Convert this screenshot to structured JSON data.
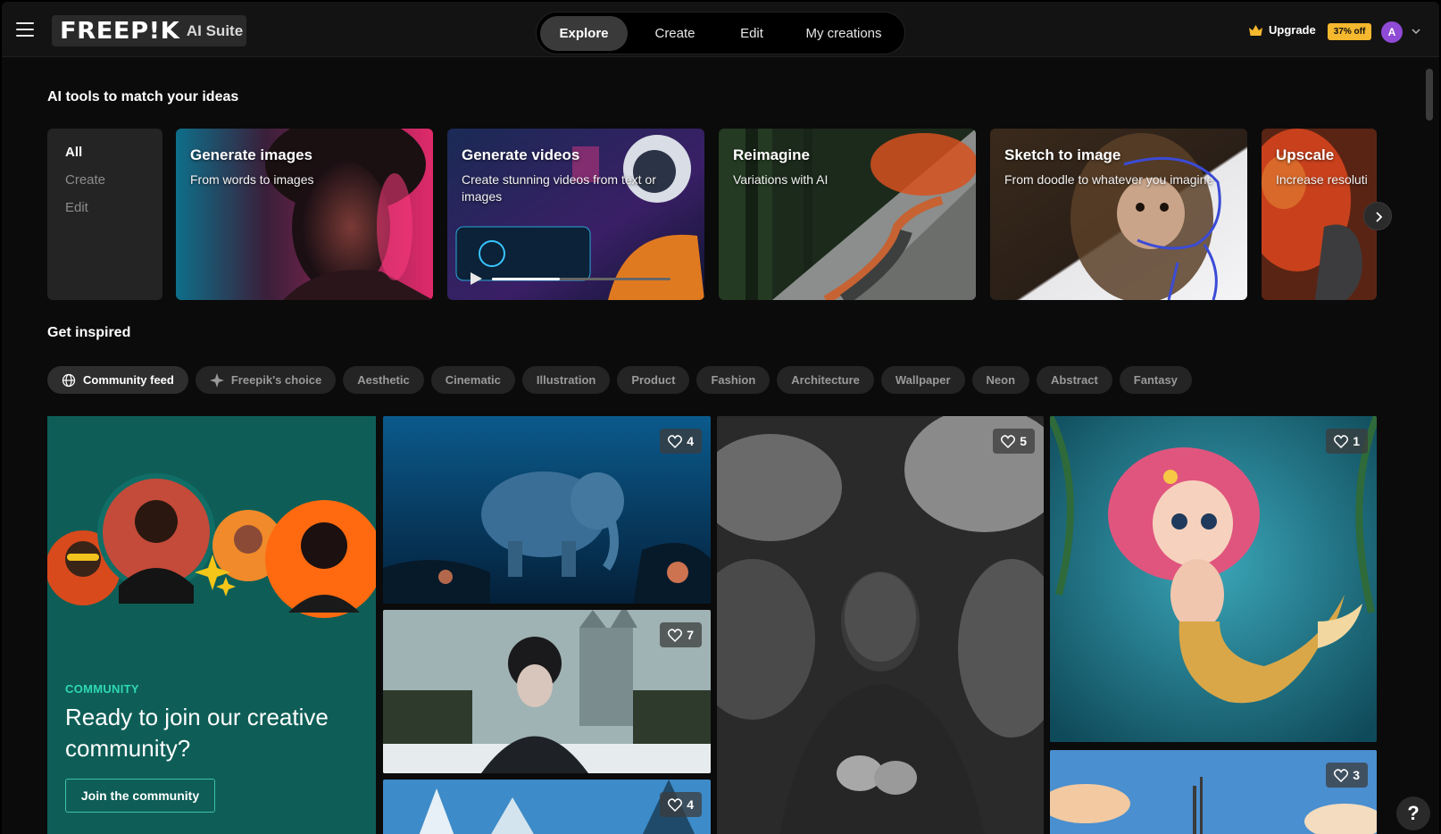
{
  "header": {
    "logo": "FREEP!K",
    "suite_label": "AI Suite",
    "nav": [
      {
        "label": "Explore",
        "active": true
      },
      {
        "label": "Create",
        "active": false
      },
      {
        "label": "Edit",
        "active": false
      },
      {
        "label": "My creations",
        "active": false
      }
    ],
    "upgrade_label": "Upgrade",
    "discount_badge": "37% off",
    "avatar_initial": "A"
  },
  "tools_section": {
    "title": "AI tools to match your ideas",
    "filters": [
      "All",
      "Create",
      "Edit"
    ],
    "active_filter": "All",
    "cards": [
      {
        "title": "Generate images",
        "subtitle": "From words to images"
      },
      {
        "title": "Generate videos",
        "subtitle": "Create stunning videos from text or images"
      },
      {
        "title": "Reimagine",
        "subtitle": "Variations with AI"
      },
      {
        "title": "Sketch to image",
        "subtitle": "From doodle to whatever you imagine"
      },
      {
        "title": "Upscale",
        "subtitle": "Increase resolution"
      }
    ]
  },
  "inspired_section": {
    "title": "Get inspired",
    "chips": [
      "Community feed",
      "Freepik's choice",
      "Aesthetic",
      "Cinematic",
      "Illustration",
      "Product",
      "Fashion",
      "Architecture",
      "Wallpaper",
      "Neon",
      "Abstract",
      "Fantasy"
    ],
    "active_chip": "Community feed"
  },
  "community_card": {
    "tag": "COMMUNITY",
    "title": "Ready to join our creative community?",
    "button": "Join the community"
  },
  "gallery": {
    "likes": [
      "4",
      "7",
      "4",
      "5",
      "1",
      "3"
    ]
  },
  "help_label": "?",
  "colors": {
    "background": "#0b0b0b",
    "community_teal": "#0e5e57",
    "accent_teal": "#2fd8b3",
    "discount_yellow": "#f5b82e",
    "avatar_purple": "#8f4ad6"
  }
}
